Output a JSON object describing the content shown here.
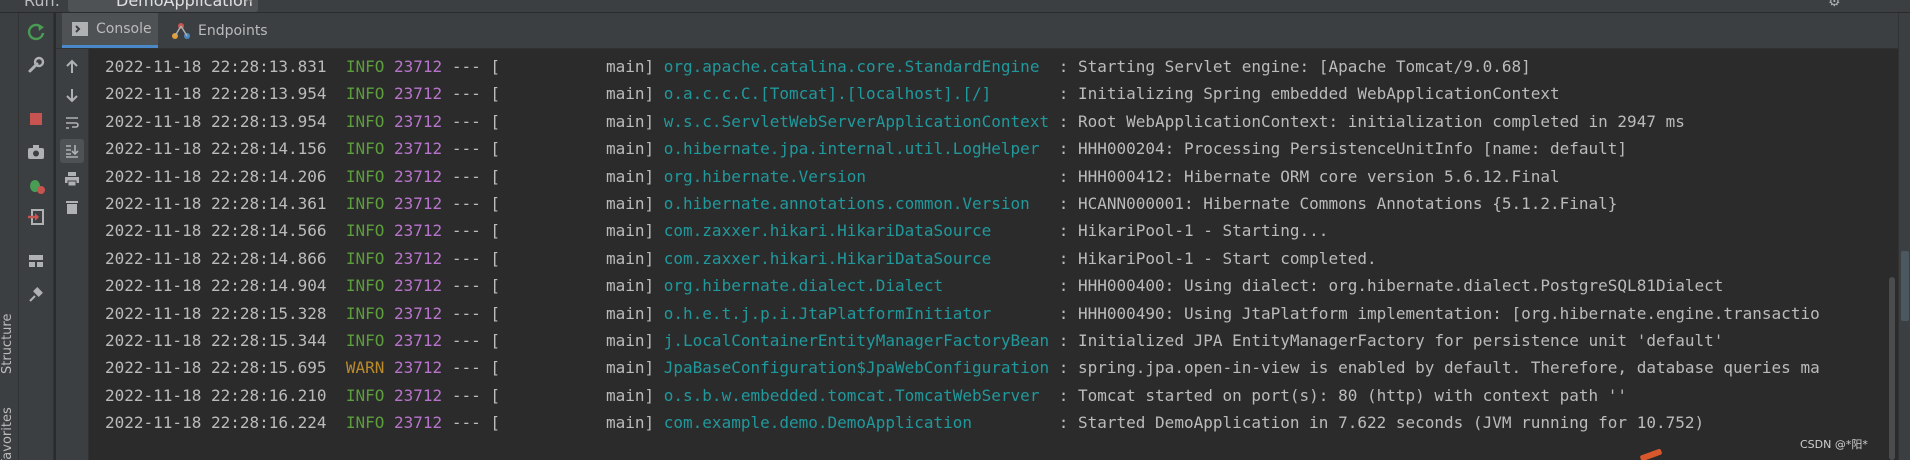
{
  "run_bar": {
    "label": "Run:",
    "tab_title": "DemoApplication",
    "close_glyph": "×"
  },
  "tabs": [
    {
      "label": "Console",
      "icon": "console-icon"
    },
    {
      "label": "Endpoints",
      "icon": "endpoints-icon"
    }
  ],
  "side_tabs": {
    "structure": "Structure",
    "favorites": "Favorites"
  },
  "colors": {
    "info": "#5c9e3c",
    "warn": "#bb8a2b",
    "pid": "#b874cc",
    "logger": "#20999d",
    "text": "#bbbbbb",
    "background": "#2b2b2b"
  },
  "log": [
    {
      "time": "2022-11-18 22:28:13.831",
      "level": "INFO",
      "pid": "23712",
      "sep": "---",
      "thread": "[           main]",
      "logger": "org.apache.catalina.core.StandardEngine",
      "msg": ": Starting Servlet engine: [Apache Tomcat/9.0.68]"
    },
    {
      "time": "2022-11-18 22:28:13.954",
      "level": "INFO",
      "pid": "23712",
      "sep": "---",
      "thread": "[           main]",
      "logger": "o.a.c.c.C.[Tomcat].[localhost].[/]",
      "msg": ": Initializing Spring embedded WebApplicationContext"
    },
    {
      "time": "2022-11-18 22:28:13.954",
      "level": "INFO",
      "pid": "23712",
      "sep": "---",
      "thread": "[           main]",
      "logger": "w.s.c.ServletWebServerApplicationContext",
      "msg": ": Root WebApplicationContext: initialization completed in 2947 ms"
    },
    {
      "time": "2022-11-18 22:28:14.156",
      "level": "INFO",
      "pid": "23712",
      "sep": "---",
      "thread": "[           main]",
      "logger": "o.hibernate.jpa.internal.util.LogHelper",
      "msg": ": HHH000204: Processing PersistenceUnitInfo [name: default]"
    },
    {
      "time": "2022-11-18 22:28:14.206",
      "level": "INFO",
      "pid": "23712",
      "sep": "---",
      "thread": "[           main]",
      "logger": "org.hibernate.Version",
      "msg": ": HHH000412: Hibernate ORM core version 5.6.12.Final"
    },
    {
      "time": "2022-11-18 22:28:14.361",
      "level": "INFO",
      "pid": "23712",
      "sep": "---",
      "thread": "[           main]",
      "logger": "o.hibernate.annotations.common.Version",
      "msg": ": HCANN000001: Hibernate Commons Annotations {5.1.2.Final}"
    },
    {
      "time": "2022-11-18 22:28:14.566",
      "level": "INFO",
      "pid": "23712",
      "sep": "---",
      "thread": "[           main]",
      "logger": "com.zaxxer.hikari.HikariDataSource",
      "msg": ": HikariPool-1 - Starting..."
    },
    {
      "time": "2022-11-18 22:28:14.866",
      "level": "INFO",
      "pid": "23712",
      "sep": "---",
      "thread": "[           main]",
      "logger": "com.zaxxer.hikari.HikariDataSource",
      "msg": ": HikariPool-1 - Start completed."
    },
    {
      "time": "2022-11-18 22:28:14.904",
      "level": "INFO",
      "pid": "23712",
      "sep": "---",
      "thread": "[           main]",
      "logger": "org.hibernate.dialect.Dialect",
      "msg": ": HHH000400: Using dialect: org.hibernate.dialect.PostgreSQL81Dialect"
    },
    {
      "time": "2022-11-18 22:28:15.328",
      "level": "INFO",
      "pid": "23712",
      "sep": "---",
      "thread": "[           main]",
      "logger": "o.h.e.t.j.p.i.JtaPlatformInitiator",
      "msg": ": HHH000490: Using JtaPlatform implementation: [org.hibernate.engine.transactio"
    },
    {
      "time": "2022-11-18 22:28:15.344",
      "level": "INFO",
      "pid": "23712",
      "sep": "---",
      "thread": "[           main]",
      "logger": "j.LocalContainerEntityManagerFactoryBean",
      "msg": ": Initialized JPA EntityManagerFactory for persistence unit 'default'"
    },
    {
      "time": "2022-11-18 22:28:15.695",
      "level": "WARN",
      "pid": "23712",
      "sep": "---",
      "thread": "[           main]",
      "logger": "JpaBaseConfiguration$JpaWebConfiguration",
      "msg": ": spring.jpa.open-in-view is enabled by default. Therefore, database queries ma"
    },
    {
      "time": "2022-11-18 22:28:16.210",
      "level": "INFO",
      "pid": "23712",
      "sep": "---",
      "thread": "[           main]",
      "logger": "o.s.b.w.embedded.tomcat.TomcatWebServer",
      "msg": ": Tomcat started on port(s): 80 (http) with context path ''"
    },
    {
      "time": "2022-11-18 22:28:16.224",
      "level": "INFO",
      "pid": "23712",
      "sep": "---",
      "thread": "[           main]",
      "logger": "com.example.demo.DemoApplication",
      "msg": ": Started DemoApplication in 7.622 seconds (JVM running for 10.752)"
    }
  ],
  "watermark": "CSDN @*阳*"
}
